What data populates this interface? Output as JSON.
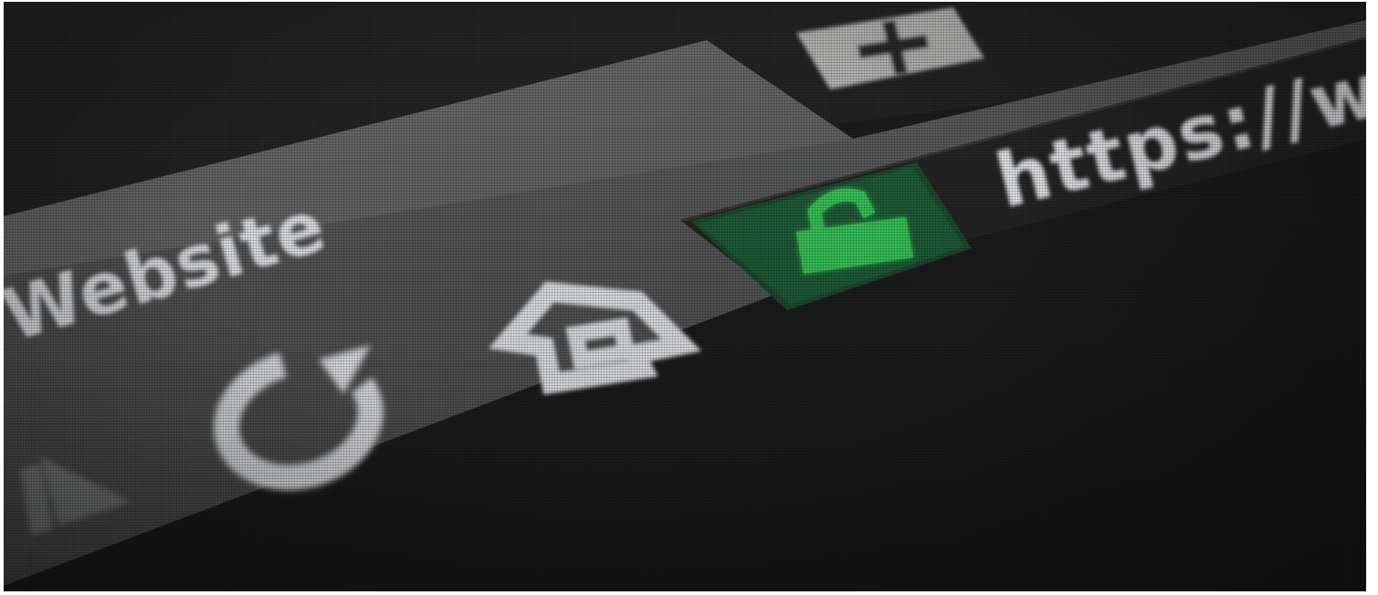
{
  "browser": {
    "tab": {
      "title": "Website"
    },
    "new_tab_button": {
      "label": "+"
    },
    "toolbar": {
      "back_icon": "back-arrow-icon",
      "reload_icon": "reload-icon",
      "home_icon": "home-icon"
    },
    "address_bar": {
      "security_icon": "lock-icon",
      "url": "https://w"
    }
  },
  "colors": {
    "background": "#1f1e1f",
    "tab_fill": "#6a6b6c",
    "toolbar_fill": "#5e5f60",
    "address_bar_fill": "#262626",
    "lock_box_fill": "#1e5a33",
    "lock_green": "#37c95a",
    "icon_white": "#e9ecef"
  }
}
